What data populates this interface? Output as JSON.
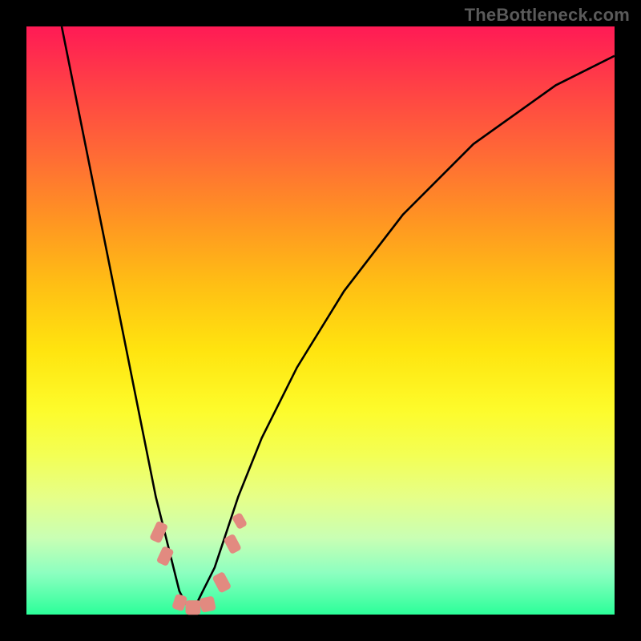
{
  "watermark": "TheBottleneck.com",
  "colors": {
    "frame_background": "#000000",
    "curve_stroke": "#000000",
    "marker_fill": "#e28a80",
    "gradient_top": "#ff1a55",
    "gradient_bottom": "#2bff99"
  },
  "chart_data": {
    "type": "line",
    "title": "",
    "xlabel": "",
    "ylabel": "",
    "xlim": [
      0,
      100
    ],
    "ylim": [
      0,
      100
    ],
    "grid": false,
    "series": [
      {
        "name": "bottleneck-curve",
        "x": [
          6,
          10,
          14,
          18,
          20,
          22,
          24,
          25,
          26,
          27,
          28,
          29,
          30,
          32,
          34,
          36,
          40,
          46,
          54,
          64,
          76,
          90,
          100
        ],
        "y": [
          100,
          80,
          60,
          40,
          30,
          20,
          12,
          8,
          4,
          2,
          1,
          2,
          4,
          8,
          14,
          20,
          30,
          42,
          55,
          68,
          80,
          90,
          95
        ]
      }
    ],
    "markers": [
      {
        "label": "left-shoulder-upper",
        "x": 22.5,
        "y": 14,
        "w": 2.0,
        "h": 3.4,
        "rot": 25
      },
      {
        "label": "left-shoulder-lower",
        "x": 23.6,
        "y": 10,
        "w": 2.0,
        "h": 3.0,
        "rot": 25
      },
      {
        "label": "valley-1",
        "x": 26.0,
        "y": 2.0,
        "w": 2.0,
        "h": 2.6,
        "rot": 18
      },
      {
        "label": "valley-2",
        "x": 28.3,
        "y": 1.2,
        "w": 2.6,
        "h": 2.4,
        "rot": 0
      },
      {
        "label": "valley-3",
        "x": 30.8,
        "y": 1.8,
        "w": 2.4,
        "h": 2.4,
        "rot": -12
      },
      {
        "label": "right-shoulder-lower",
        "x": 33.2,
        "y": 5.5,
        "w": 2.2,
        "h": 3.2,
        "rot": -28
      },
      {
        "label": "right-shoulder-upper",
        "x": 35.0,
        "y": 12.0,
        "w": 2.0,
        "h": 3.0,
        "rot": -28
      },
      {
        "label": "right-shoulder-top",
        "x": 36.3,
        "y": 16.0,
        "w": 1.8,
        "h": 2.4,
        "rot": -30
      }
    ]
  }
}
